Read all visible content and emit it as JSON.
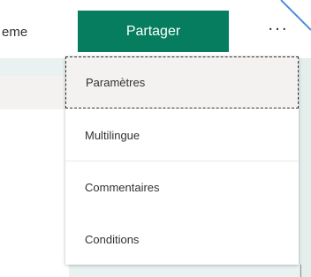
{
  "toolbar": {
    "left_label": "eme",
    "share_label": "Partager",
    "more_label": "···"
  },
  "menu": {
    "items": [
      {
        "label": "Paramètres",
        "state": "focused"
      },
      {
        "label": "Multilingue"
      },
      {
        "label": "Commentaires"
      },
      {
        "label": "Conditions"
      }
    ]
  },
  "colors": {
    "accent": "#077d5f",
    "text": "#323130",
    "background_tint": "#e9f2f1",
    "menu_hover": "#f3f2f1"
  }
}
